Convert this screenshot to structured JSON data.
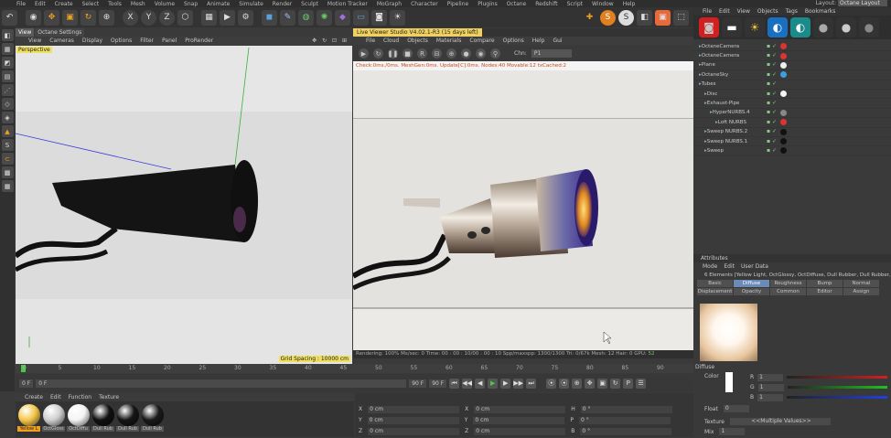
{
  "menu": {
    "items": [
      "File",
      "Edit",
      "Create",
      "Select",
      "Tools",
      "Mesh",
      "Volume",
      "Snap",
      "Animate",
      "Simulate",
      "Render",
      "Sculpt",
      "Motion Tracker",
      "MoGraph",
      "Character",
      "Pipeline",
      "Plugins",
      "Octane",
      "Redshift",
      "Script",
      "Window",
      "Help"
    ],
    "layout_label": "Layout:",
    "layout_value": "Octane Layout"
  },
  "viewport": {
    "tabs": [
      "View",
      "Octane Settings"
    ],
    "menu": [
      "View",
      "Cameras",
      "Display",
      "Options",
      "Filter",
      "Panel",
      "ProRender"
    ],
    "camera_label": "Perspective",
    "grid_label": "Grid Spacing : 10000 cm",
    "nav": "✥ ↻ ⊡ ⊞"
  },
  "live": {
    "tab": "Live Viewer Studio V4.02.1-R3 (15 days left)",
    "menu": [
      "File",
      "Cloud",
      "Objects",
      "Materials",
      "Compare",
      "Options",
      "Help",
      "Gui"
    ],
    "chn_label": "Chn:",
    "chn_value": "P1",
    "status": "Check:0ms./0ms. MeshGen:0ms. Update[C]:0ms. Nodes:40 Movable:12 txCached:2",
    "bottom": "Rendering: 100% Ms/sec: 0  Time: 00 : 00 : 10/00 : 00 : 10  Spp/maxspp: 1300/1300  Tri: 0/67k  Mesh: 12  Hair: 0  GPU:",
    "gpu": "52"
  },
  "timeline": {
    "ticks": [
      "0",
      "5",
      "10",
      "15",
      "20",
      "25",
      "30",
      "35",
      "40",
      "45",
      "50",
      "55",
      "60",
      "65",
      "70",
      "75",
      "80",
      "85",
      "90"
    ],
    "start": "0 F",
    "start2": "0 F",
    "end": "90 F",
    "end2": "90 F",
    "frame": "0 F"
  },
  "materials": {
    "menu": [
      "Create",
      "Edit",
      "Function",
      "Texture"
    ],
    "items": [
      {
        "label": "Yellow L",
        "color": "#f6c64a"
      },
      {
        "label": "OctGloss",
        "color": "#cfcfcf"
      },
      {
        "label": "OctDiffu",
        "color": "#f4f4f4"
      },
      {
        "label": "Dull Rub",
        "color": "#111111"
      },
      {
        "label": "Dull Rub",
        "color": "#161616"
      },
      {
        "label": "Dull Rub",
        "color": "#1a1a1a"
      }
    ]
  },
  "coords": {
    "rows": [
      [
        "X",
        "0 cm",
        "X",
        "0 cm",
        "H",
        "0 °"
      ],
      [
        "Y",
        "0 cm",
        "Y",
        "0 cm",
        "P",
        "0 °"
      ],
      [
        "Z",
        "0 cm",
        "Z",
        "0 cm",
        "B",
        "0 °"
      ]
    ]
  },
  "objects": {
    "menu": [
      "File",
      "Edit",
      "View",
      "Objects",
      "Tags",
      "Bookmarks"
    ],
    "tree": [
      {
        "name": "OctaneCamera",
        "indent": 0,
        "tag": "#d33"
      },
      {
        "name": "OctaneCamera",
        "indent": 0,
        "tag": "#d33"
      },
      {
        "name": "Plane",
        "indent": 0,
        "tag": "#eee"
      },
      {
        "name": "OctaneSky",
        "indent": 0,
        "tag": "#3aa0e0"
      },
      {
        "name": "Tubes",
        "indent": 0,
        "tag": ""
      },
      {
        "name": "Disc",
        "indent": 1,
        "tag": "#f5f5f5"
      },
      {
        "name": "Exhaust-Pipe",
        "indent": 1,
        "tag": ""
      },
      {
        "name": "HyperNURBS.4",
        "indent": 2,
        "tag": "#888"
      },
      {
        "name": "Loft NURBS",
        "indent": 3,
        "tag": "#d33"
      },
      {
        "name": "Sweep NURBS.2",
        "indent": 1,
        "tag": "#111"
      },
      {
        "name": "Sweep NURBS.1",
        "indent": 1,
        "tag": "#111"
      },
      {
        "name": "Sweep",
        "indent": 1,
        "tag": "#111"
      }
    ]
  },
  "attributes": {
    "header": "Attributes",
    "menu": [
      "Mode",
      "Edit",
      "User Data"
    ],
    "title": "6 Elements [Yellow Light, OctGlossy, OctDiffuse, Dull Rubber, Dull Rubber, Dull Rubber.2]",
    "tabs": [
      "Basic",
      "Diffuse",
      "Roughness",
      "Bump",
      "Normal",
      "Displacement",
      "Opacity",
      "Common",
      "Editor",
      "Assign"
    ],
    "section": "Diffuse",
    "color_label": "Color",
    "r": "1",
    "g": "1",
    "b": "1",
    "float_label": "Float",
    "float_value": "0",
    "texture_label": "Texture",
    "texture_value": "<<Multiple Values>>",
    "mix_label": "Mix",
    "mix_value": "1"
  }
}
